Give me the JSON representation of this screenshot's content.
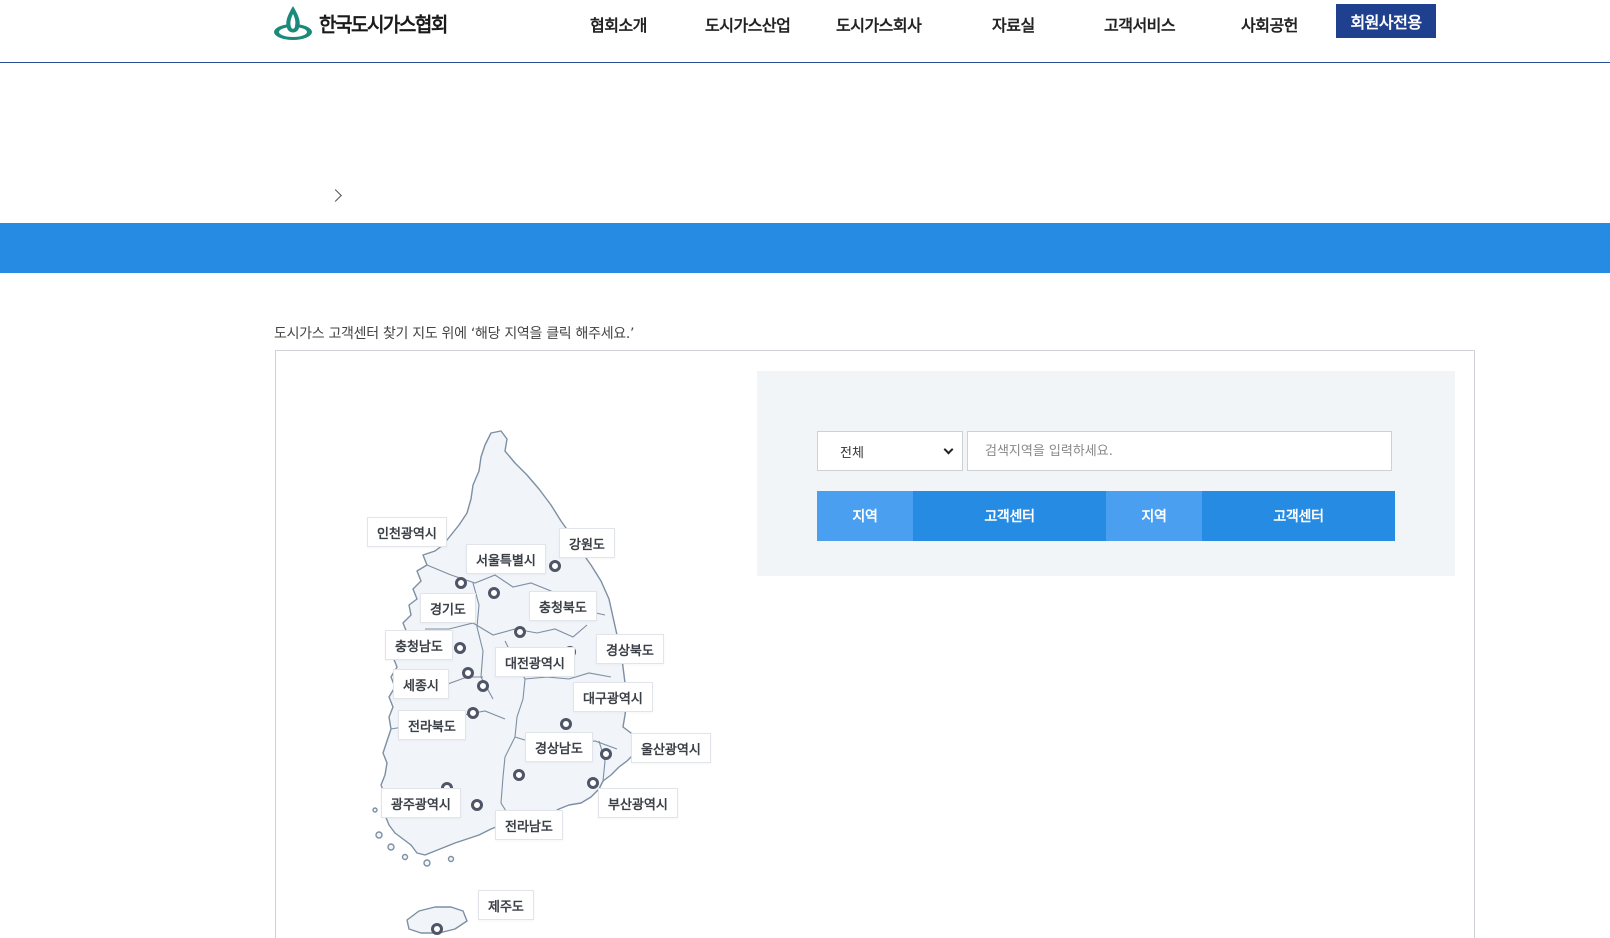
{
  "header": {
    "logo_text": "한국도시가스협회",
    "nav": [
      "협회소개",
      "도시가스산업",
      "도시가스회사",
      "자료실",
      "고객서비스",
      "사회공헌"
    ],
    "member_button": "회원사전용"
  },
  "main": {
    "instruction": "도시가스 고객센터 찾기 지도 위에 ‘해당 지역을 클릭 해주세요.’",
    "search": {
      "select_value": "전체",
      "input_placeholder": "검색지역을 입력하세요."
    },
    "table_headers": [
      "지역",
      "고객센터",
      "지역",
      "고객센터"
    ]
  },
  "map": {
    "regions": [
      "인천광역시",
      "서울특별시",
      "강원도",
      "경기도",
      "충청북도",
      "충청남도",
      "경상북도",
      "대전광역시",
      "세종시",
      "대구광역시",
      "전라북도",
      "경상남도",
      "울산광역시",
      "광주광역시",
      "부산광역시",
      "전라남도",
      "제주도"
    ]
  },
  "colors": {
    "brand_navy": "#1f3f8f",
    "band_blue": "#258be3",
    "th_light_blue": "#4a9ff0",
    "search_bg": "#f2f5f8"
  },
  "icons": [
    "logo-emblem-icon",
    "chevron-right-icon",
    "chevron-down-icon"
  ]
}
